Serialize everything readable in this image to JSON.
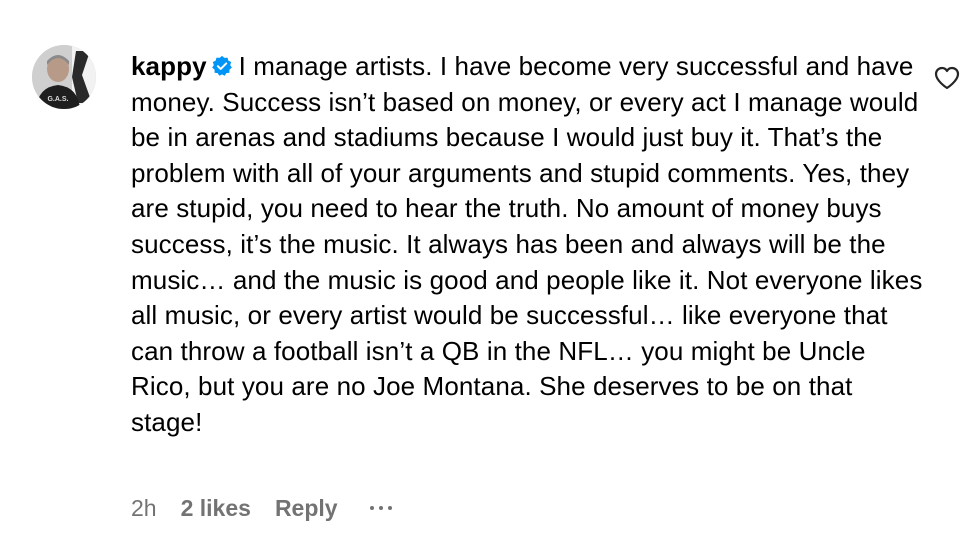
{
  "comment": {
    "avatar_text": "G.A.S.",
    "username": "kappy",
    "verified_icon": "verified-badge-icon",
    "text": "I manage artists. I have become very successful and have money. Success isn’t based on money, or every act I manage would be in arenas and stadiums because I would just buy it. That’s the problem with all of your arguments and stupid comments. Yes, they are stupid, you need to hear the truth. No amount of money buys success, it’s the music. It always has been and always will be the music… and the music is good and people like it. Not everyone likes all music, or every artist would be successful… like everyone that can throw a football isn’t a QB in the NFL… you might be Uncle Rico, but you are no Joe Montana. She deserves to be on that stage!",
    "time": "2h",
    "likes": "2 likes",
    "reply_label": "Reply",
    "like_icon": "heart-outline-icon",
    "more_icon": "more-options-icon"
  },
  "colors": {
    "text": "#000000",
    "meta": "#737373",
    "verified": "#0095f6",
    "background": "#ffffff"
  }
}
